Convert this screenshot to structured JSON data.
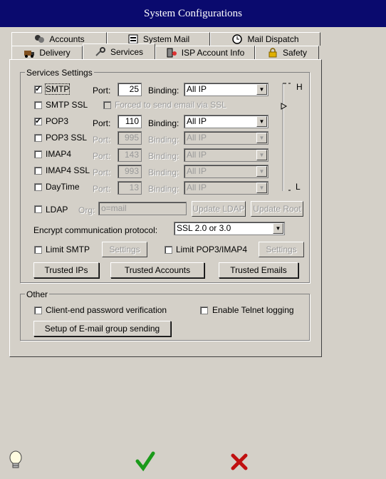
{
  "window": {
    "title": "System Configurations"
  },
  "tabs_top": [
    {
      "label": "Accounts",
      "icon": "accounts-icon"
    },
    {
      "label": "System Mail",
      "icon": "system-mail-icon"
    },
    {
      "label": "Mail Dispatch",
      "icon": "clock-icon"
    }
  ],
  "tabs_bottom": [
    {
      "label": "Delivery",
      "icon": "delivery-icon"
    },
    {
      "label": "Services",
      "icon": "services-icon",
      "active": true
    },
    {
      "label": "ISP Account Info",
      "icon": "isp-icon"
    },
    {
      "label": "Safety",
      "icon": "lock-icon"
    }
  ],
  "services": {
    "group_title": "Services Settings",
    "port_label": "Port:",
    "binding_label": "Binding:",
    "smtp": {
      "label": "SMTP",
      "checked": true,
      "port": "25",
      "binding": "All IP"
    },
    "smtp_ssl": {
      "label": "SMTP SSL",
      "checked": false,
      "forced_label": "Forced to send email via SSL"
    },
    "pop3": {
      "label": "POP3",
      "checked": true,
      "port": "110",
      "binding": "All IP"
    },
    "pop3_ssl": {
      "label": "POP3 SSL",
      "checked": false,
      "port": "995",
      "binding": "All IP"
    },
    "imap4": {
      "label": "IMAP4",
      "checked": false,
      "port": "143",
      "binding": "All IP"
    },
    "imap4_ssl": {
      "label": "IMAP4 SSL",
      "checked": false,
      "port": "993",
      "binding": "All IP"
    },
    "daytime": {
      "label": "DayTime",
      "checked": false,
      "port": "13",
      "binding": "All IP"
    },
    "ldap": {
      "label": "LDAP",
      "checked": false,
      "org_label": "Org:",
      "org_value": "o=mail",
      "update_ldap": "Update LDAP",
      "update_root": "Update Root"
    },
    "encrypt_label": "Encrypt communication protocol:",
    "encrypt_value": "SSL 2.0 or 3.0",
    "limit_smtp": "Limit SMTP",
    "limit_pop3": "Limit POP3/IMAP4",
    "settings_label": "Settings",
    "trusted_ips": "Trusted IPs",
    "trusted_accounts": "Trusted Accounts",
    "trusted_emails": "Trusted Emails",
    "slider_high": "H",
    "slider_low": "L"
  },
  "other": {
    "group_title": "Other",
    "client_pw": "Client-end password verification",
    "telnet": "Enable Telnet logging",
    "email_group": "Setup of E-mail group sending"
  },
  "colors": {
    "title_bg": "#0a0a6e",
    "face": "#d4d0c8",
    "ok_green": "#1a9a1a",
    "cancel_red": "#c01010"
  }
}
